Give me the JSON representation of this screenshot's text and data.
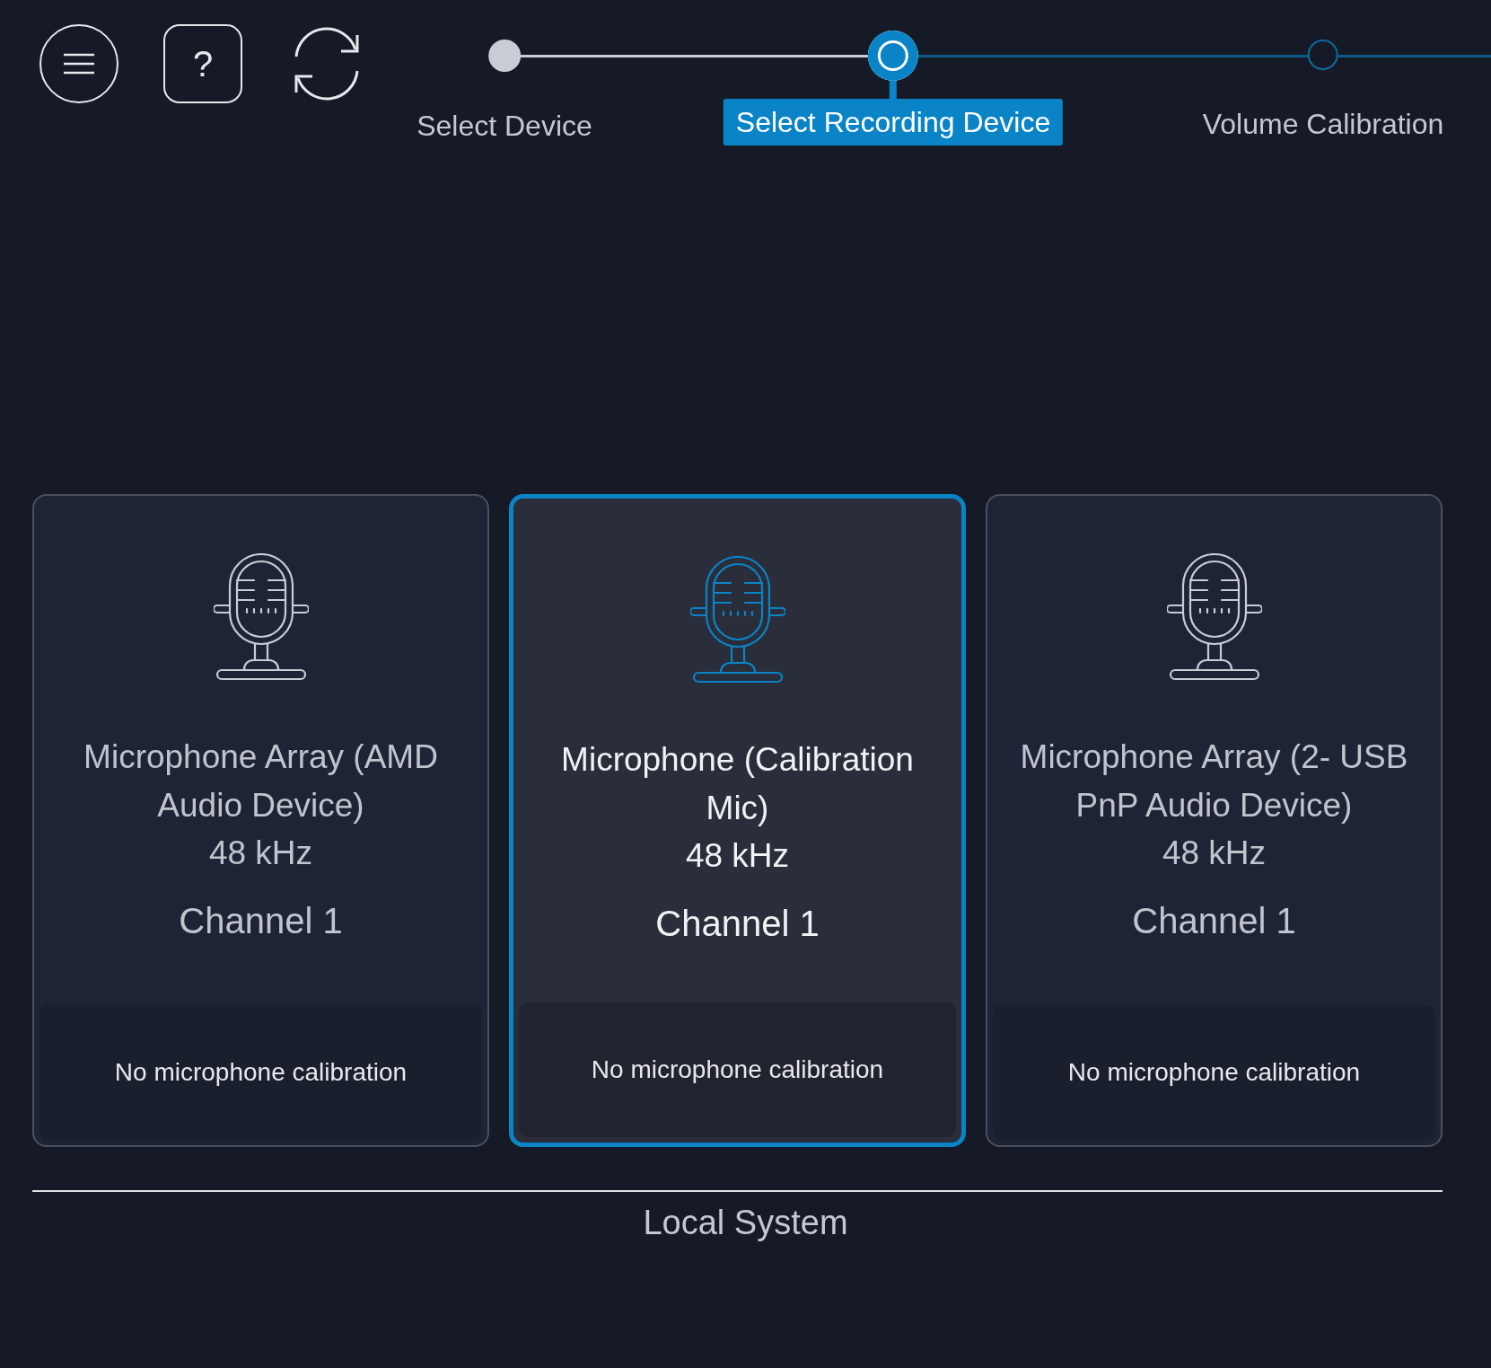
{
  "toolbar": {
    "buttons": [
      {
        "kind": "menu"
      },
      {
        "kind": "help",
        "label": "?"
      },
      {
        "kind": "refresh"
      }
    ]
  },
  "steps": [
    {
      "label": "Select Device",
      "completed": true,
      "selected": false
    },
    {
      "label": "Select Recording Device",
      "completed": false,
      "selected": true
    },
    {
      "label": "Volume Calibration",
      "completed": false,
      "selected": false
    }
  ],
  "devices": [
    {
      "name": "Microphone Array (AMD Audio Device)",
      "rate": "48 kHz",
      "channel": "Channel 1",
      "calibration": "No microphone calibration",
      "selected": false
    },
    {
      "name": "Microphone (Calibration Mic)",
      "rate": "48 kHz",
      "channel": "Channel 1",
      "calibration": "No microphone calibration",
      "selected": true
    },
    {
      "name": "Microphone Array (2- USB PnP Audio Device)",
      "rate": "48 kHz",
      "channel": "Channel 1",
      "calibration": "No microphone calibration",
      "selected": false
    }
  ],
  "group_label": "Local System"
}
